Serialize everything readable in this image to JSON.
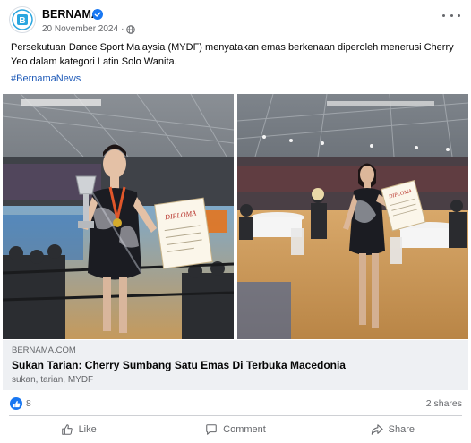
{
  "post": {
    "page_name": "BERNAMA",
    "date": "20 November 2024",
    "separator": "·",
    "text": "Persekutuan Dance Sport Malaysia (MYDF) menyatakan emas berkenaan diperoleh menerusi Cherry Yeo dalam kategori Latin Solo Wanita.",
    "hashtag": "#BernamaNews",
    "avatar_letter": "B"
  },
  "photos": {
    "left": {
      "certificate_text": "DIPLOMA"
    },
    "right": {
      "certificate_text": "DIPLOMA"
    }
  },
  "link_preview": {
    "domain": "BERNAMA.COM",
    "title": "Sukan Tarian: Cherry Sumbang Satu Emas Di Terbuka Macedonia",
    "description": "sukan, tarian, MYDF"
  },
  "engagement": {
    "likes": "8",
    "shares": "2 shares"
  },
  "actions": {
    "like": "Like",
    "comment": "Comment",
    "share": "Share"
  },
  "colors": {
    "accent": "#1877f2",
    "hashtag": "#1d59b7",
    "secondary_text": "#65676b",
    "link_box": "#eef0f3"
  },
  "icons": {
    "verified": "verified-badge-icon",
    "audience": "globe-icon",
    "more": "more-options-icon",
    "like": "thumbs-up-icon",
    "comment": "comment-bubble-icon",
    "share": "share-arrow-icon"
  }
}
